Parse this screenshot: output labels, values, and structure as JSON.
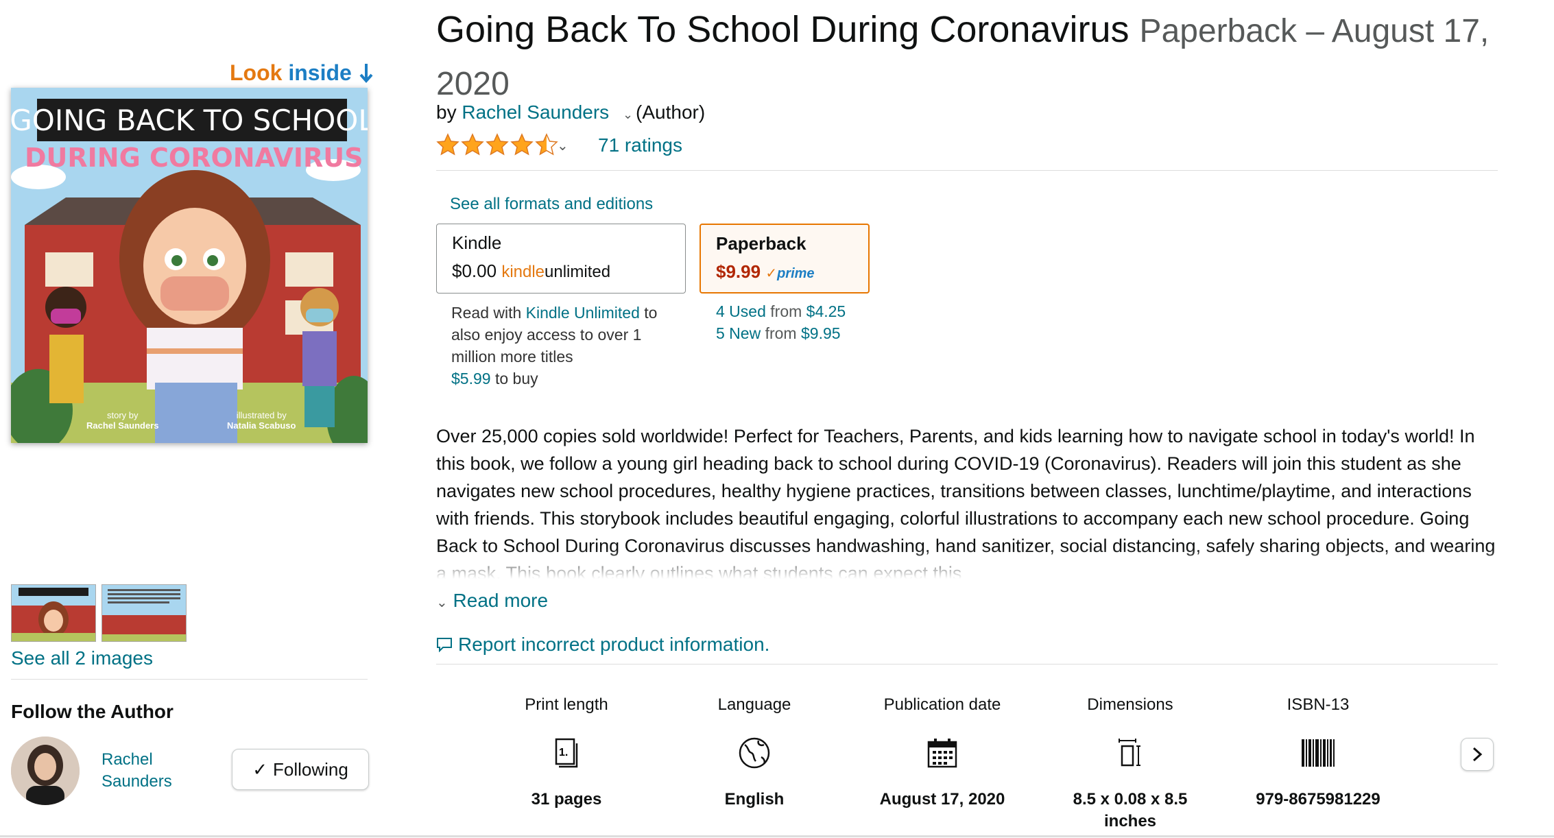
{
  "look_inside": {
    "part1": "Look ",
    "part2": "inside"
  },
  "cover": {
    "title_line1": "GOING BACK TO SCHOOL",
    "title_line2": "DURING CORONAVIRUS",
    "story_by_label": "story by",
    "story_by_name": "Rachel Saunders",
    "illustrated_by_label": "illustrated by",
    "illustrated_by_name": "Natalia Scabuso"
  },
  "gallery": {
    "see_all": "See all 2 images"
  },
  "follow": {
    "title": "Follow the Author",
    "author_name": "Rachel Saunders",
    "following_label": "Following"
  },
  "product": {
    "title": "Going Back To School During Coronavirus",
    "format_date": "Paperback – August 17, 2020",
    "by": "by",
    "author": "Rachel Saunders",
    "role": "(Author)",
    "rating": 4.5,
    "ratings_count": "71 ratings"
  },
  "formats": {
    "see_all": "See all formats and editions",
    "kindle": {
      "name": "Kindle",
      "price": "$0.00",
      "ku_kindle": "kindle",
      "ku_unlimited": "unlimited"
    },
    "kindle_note": {
      "read_with": "Read with",
      "ku_link": "Kindle Unlimited",
      "body": "to also enjoy access to over 1 million more titles",
      "buy_price": "$5.99",
      "buy_suffix": "to buy"
    },
    "paperback": {
      "name": "Paperback",
      "price": "$9.99",
      "prime": "prime"
    },
    "paperback_offers": {
      "used_link": "4 Used",
      "used_from": "from",
      "used_price": "$4.25",
      "new_link": "5 New",
      "new_from": "from",
      "new_price": "$9.95"
    }
  },
  "description": {
    "text": "Over 25,000 copies sold worldwide! Perfect for Teachers, Parents, and kids learning how to navigate school in today's world! In this book, we follow a young girl heading back to school during COVID-19 (Coronavirus). Readers will join this student as she navigates new school procedures, healthy hygiene practices, transitions between classes, lunchtime/playtime, and interactions with friends. This storybook includes beautiful engaging, colorful illustrations to accompany each new school procedure. Going Back to School During Coronavirus discusses handwashing, hand sanitizer, social distancing, safely sharing objects, and wearing a mask. This book clearly outlines what students can expect this",
    "read_more": "Read more",
    "report": "Report incorrect product information."
  },
  "details": [
    {
      "label": "Print length",
      "icon": "book-pages-icon",
      "value": "31 pages"
    },
    {
      "label": "Language",
      "icon": "globe-icon",
      "value": "English"
    },
    {
      "label": "Publication date",
      "icon": "calendar-icon",
      "value": "August 17, 2020"
    },
    {
      "label": "Dimensions",
      "icon": "dimensions-icon",
      "value": "8.5 x 0.08 x 8.5 inches"
    },
    {
      "label": "ISBN-13",
      "icon": "barcode-icon",
      "value": "979-8675981229"
    }
  ],
  "colors": {
    "link": "#007185",
    "price": "#b12704",
    "star": "#ffa41c",
    "selected_border": "#e77600"
  }
}
